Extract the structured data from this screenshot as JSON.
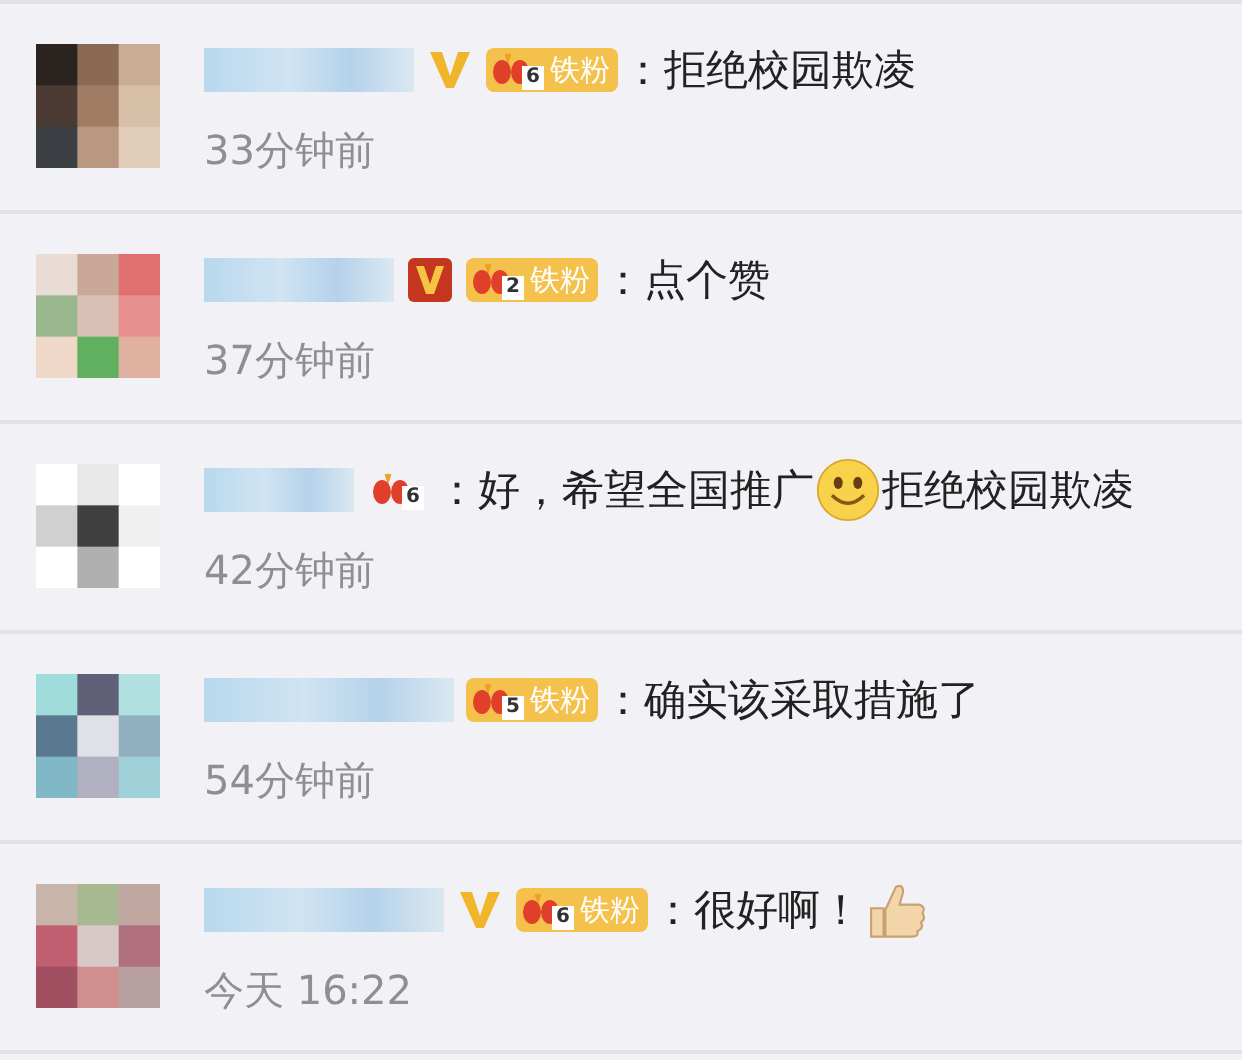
{
  "comments": [
    {
      "v_badge": {
        "kind": "gold"
      },
      "fan_badge": {
        "level": "6",
        "label": "铁粉"
      },
      "content": [
        {
          "kind": "text",
          "text": "：拒绝校园欺凌"
        }
      ],
      "time": "33分钟前"
    },
    {
      "v_badge": {
        "kind": "red"
      },
      "fan_badge": {
        "level": "2",
        "label": "铁粉"
      },
      "content": [
        {
          "kind": "text",
          "text": "：点个赞"
        }
      ],
      "time": "37分钟前"
    },
    {
      "fan_badge": {
        "level": "6"
      },
      "content": [
        {
          "kind": "text",
          "text": "：好，希望全国推广"
        },
        {
          "kind": "smile"
        },
        {
          "kind": "text",
          "text": "拒绝校园欺凌"
        }
      ],
      "time": "42分钟前"
    },
    {
      "fan_badge": {
        "level": "5",
        "label": "铁粉"
      },
      "content": [
        {
          "kind": "text",
          "text": "：确实该采取措施了"
        }
      ],
      "time": "54分钟前"
    },
    {
      "v_badge": {
        "kind": "gold"
      },
      "fan_badge": {
        "level": "6",
        "label": "铁粉"
      },
      "content": [
        {
          "kind": "text",
          "text": "：很好啊！"
        },
        {
          "kind": "thumb"
        }
      ],
      "time": "今天 16:22"
    }
  ]
}
